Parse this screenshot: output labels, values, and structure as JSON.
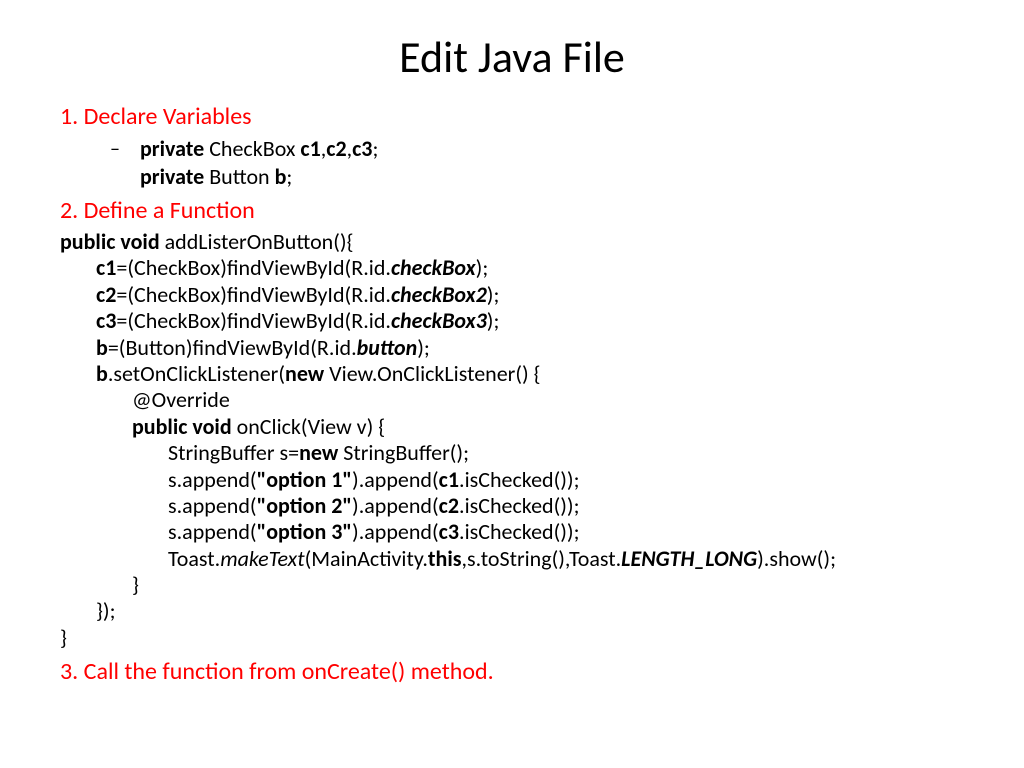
{
  "title": "Edit Java File",
  "section1": "1. Declare Variables",
  "vars_dash": "–",
  "vars_kw_private1": "private",
  "vars_type1": " CheckBox ",
  "vars_c1": "c1",
  "vars_comma1": ",",
  "vars_c2": "c2",
  "vars_comma2": ",",
  "vars_c3": "c3",
  "vars_semi1": ";",
  "vars_kw_private2": "private",
  "vars_type2": " Button ",
  "vars_b": "b",
  "vars_semi2": ";",
  "section2": "2. Define a Function",
  "sig_public_void": "public void",
  "sig_rest": " addListerOnButton(){",
  "l_c1_lhs": "c1",
  "l_c1_mid": "=(CheckBox)findViewById(R.id.",
  "l_c1_id": "checkBox",
  "l_c1_end": ");",
  "l_c2_lhs": "c2",
  "l_c2_mid": "=(CheckBox)findViewById(R.id.",
  "l_c2_id": "checkBox2",
  "l_c2_end": ");",
  "l_c3_lhs": "c3",
  "l_c3_mid": "=(CheckBox)findViewById(R.id.",
  "l_c3_id": "checkBox3",
  "l_c3_end": ");",
  "l_b_lhs": "b",
  "l_b_mid": "=(Button)findViewById(R.id.",
  "l_b_id": "button",
  "l_b_end": ");",
  "l_listener_b": "b",
  "l_listener_mid1": ".setOnClickListener(",
  "l_listener_new": "new",
  "l_listener_mid2": " View.OnClickListener() {",
  "l_override": "@Override",
  "l_onclick_kw": "public void",
  "l_onclick_rest": " onClick(View v) {",
  "l_sb_pre": "StringBuffer s=",
  "l_sb_new": "new",
  "l_sb_post": " StringBuffer();",
  "l_ap1_a": "s.append(",
  "l_ap1_str": "\"option 1\"",
  "l_ap1_b": ").append(",
  "l_ap1_c": "c1",
  "l_ap1_d": ".isChecked());",
  "l_ap2_a": "s.append(",
  "l_ap2_str": "\"option 2\"",
  "l_ap2_b": ").append(",
  "l_ap2_c": "c2",
  "l_ap2_d": ".isChecked());",
  "l_ap3_a": "s.append(",
  "l_ap3_str": "\"option 3\"",
  "l_ap3_b": ").append(",
  "l_ap3_c": "c3",
  "l_ap3_d": ".isChecked());",
  "l_toast_a": "Toast.",
  "l_toast_make": "makeText",
  "l_toast_b": "(MainActivity.",
  "l_toast_this": "this",
  "l_toast_c": ",s.toString(),Toast.",
  "l_toast_len": "LENGTH_LONG",
  "l_toast_d": ").show();",
  "l_close_inner": "}",
  "l_close_listener": "});",
  "l_close_method": "}",
  "section3": "3. Call the function from onCreate() method."
}
